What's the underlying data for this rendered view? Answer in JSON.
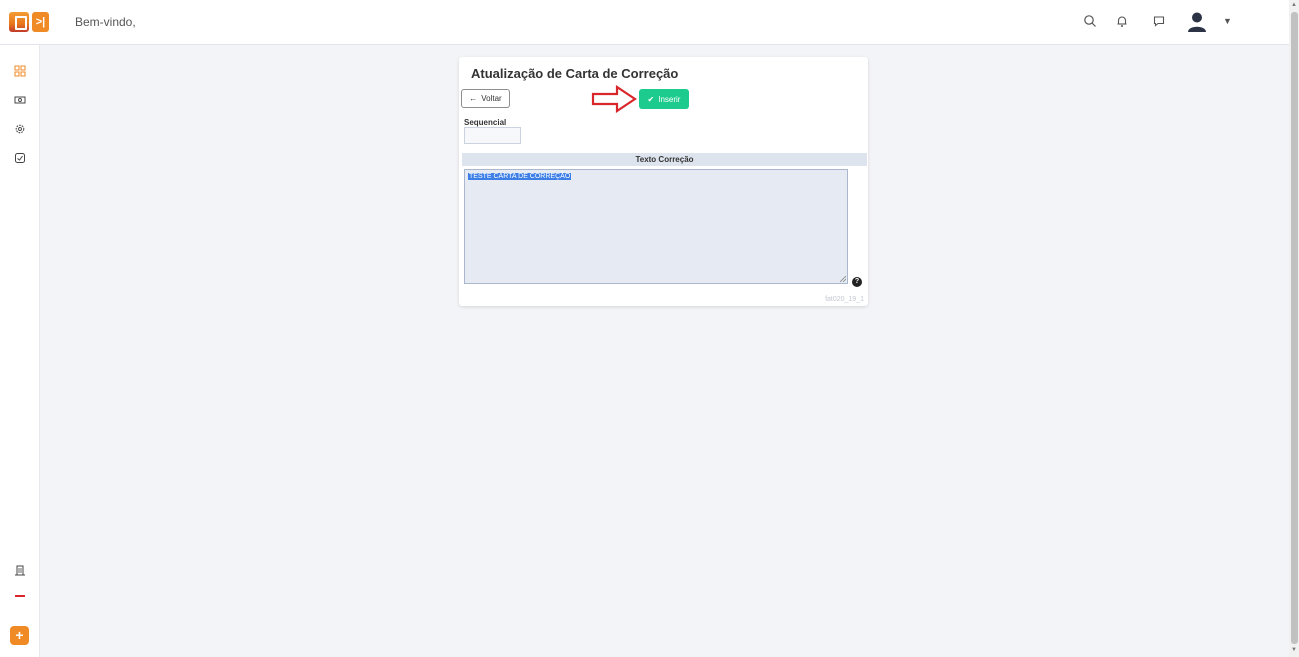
{
  "header": {
    "welcome": "Bem-vindo,"
  },
  "icons": {
    "logo": "app-logo-icon",
    "collapse": "collapse-sidebar-icon",
    "search": "search-icon",
    "notifications": "bell-icon",
    "messages": "chat-icon",
    "user": "user-avatar-icon",
    "menu_caret": "caret-down-icon"
  },
  "card": {
    "title": "Atualização de Carta de Correção",
    "back_label": "Voltar",
    "insert_label": "Inserir",
    "sequencial_label": "Sequencial",
    "sequencial_value": "",
    "section_header": "Texto Correção",
    "correction_text": "TESTE CARTA DE CORREÇÃO",
    "help_glyph": "?",
    "footer_code": "fat020_19_1"
  },
  "colors": {
    "accent_orange": "#f08a24",
    "insert_green": "#1ecb8f",
    "annotation_red": "#d9262b",
    "selection_blue": "#3d7fe6"
  }
}
